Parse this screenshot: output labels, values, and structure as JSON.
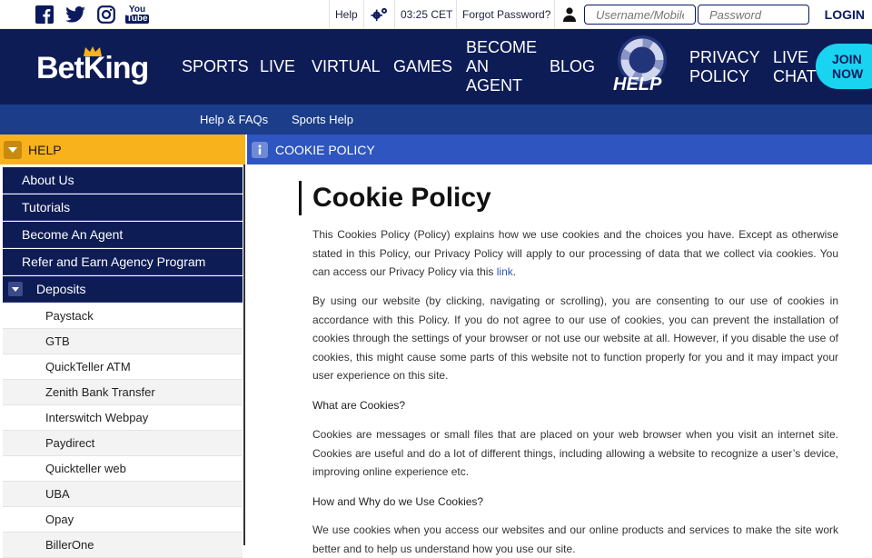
{
  "topbar": {
    "help": "Help",
    "time": "03:25 CET",
    "forgot": "Forgot Password?",
    "username_placeholder": "Username/Mobile",
    "password_placeholder": "Password",
    "login": "LOGIN",
    "social_icons": [
      "facebook-icon",
      "twitter-icon",
      "instagram-icon",
      "youtube-icon"
    ],
    "youtube_top": "You",
    "youtube_bottom": "Tube"
  },
  "brand": {
    "name": "BetKing",
    "accent": "#f7b21c"
  },
  "nav": {
    "sports": "SPORTS",
    "live": "LIVE",
    "virtual": "VIRTUAL",
    "games": "GAMES",
    "agent_1": "BECOME",
    "agent_2": "AN",
    "agent_3": "AGENT",
    "blog": "BLOG",
    "help_badge": "HELP",
    "privacy_1": "PRIVACY",
    "privacy_2": "POLICY",
    "chat_1": "LIVE",
    "chat_2": "CHAT",
    "join_1": "JOIN",
    "join_2": "NOW"
  },
  "subnav": {
    "help_faqs": "Help & FAQs",
    "sports_help": "Sports Help"
  },
  "sidebar": {
    "header": "HELP",
    "items": [
      "About Us",
      "Tutorials",
      "Become An Agent",
      "Refer and Earn Agency Program",
      "Deposits"
    ],
    "deposits": [
      "Paystack",
      "GTB",
      "QuickTeller ATM",
      "Zenith Bank Transfer",
      "Interswitch Webpay",
      "Paydirect",
      "Quickteller web",
      "UBA",
      "Opay",
      "BillerOne"
    ]
  },
  "content": {
    "section": "COOKIE POLICY",
    "title": "Cookie Policy",
    "p1_a": "This Cookies Policy (Policy) explains how we use cookies and the choices you have. Except as otherwise stated in this Policy, our Privacy Policy will apply to our processing of data that we collect via cookies. You can access our Privacy Policy via this ",
    "p1_link": "link",
    "p1_end": ".",
    "p2": "By using our website (by clicking, navigating or scrolling), you are consenting to our use of cookies in accordance with this Policy. If you do not agree to our use of cookies, you can prevent the installation of cookies through the settings of your browser or not use our website at all. However, if you disable the use of cookies, this might cause some parts of this website not to function properly for you and it may impact your user experience on this site.",
    "h1": "What are Cookies?",
    "p3": "Cookies are messages or small files that are placed on your web browser when you visit an internet site. Cookies are useful and do a lot of different things, including allowing a website to recognize a user’s device, improving online experience etc.",
    "h2": "How and Why do we Use Cookies?",
    "p4": "We use cookies when you access our websites and our online products and services to make the site work better and to help us understand how you use our site."
  }
}
